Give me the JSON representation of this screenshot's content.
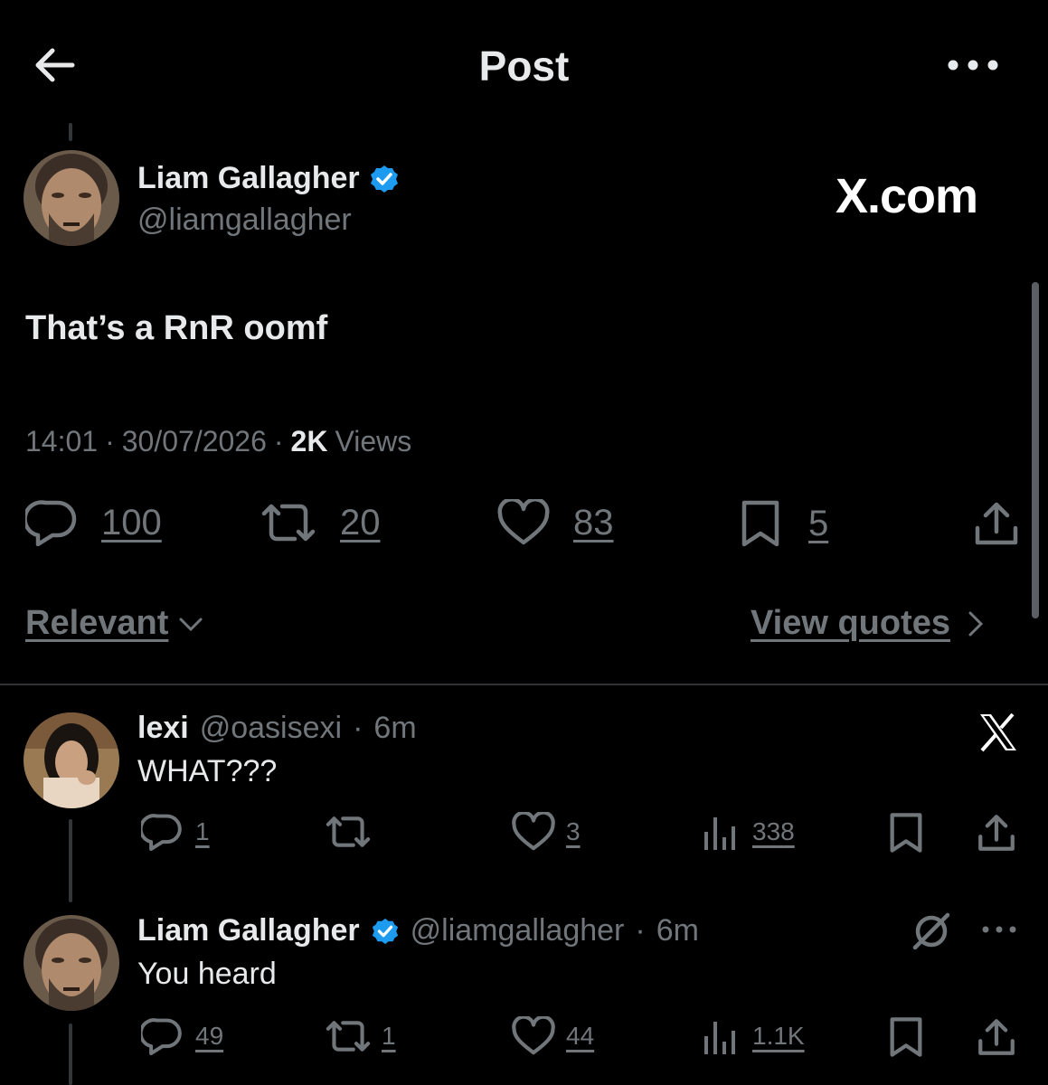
{
  "header": {
    "title": "Post"
  },
  "main_post": {
    "author_name": "Liam Gallagher",
    "author_handle": "@liamgallagher",
    "watermark": "X.com",
    "text": "That’s a RnR oomf",
    "time": "14:01",
    "date": "30/07/2026",
    "views_count": "2K",
    "views_label": "Views",
    "replies": "100",
    "reposts": "20",
    "likes": "83",
    "bookmarks": "5"
  },
  "sort": {
    "label": "Relevant",
    "view_quotes": "View quotes"
  },
  "replies": [
    {
      "name": "lexi",
      "handle": "@oasisexi",
      "time": "6m",
      "text": "WHAT???",
      "replies": "1",
      "reposts": "",
      "likes": "3",
      "views": "338"
    },
    {
      "name": "Liam Gallagher",
      "handle": "@liamgallagher",
      "time": "6m",
      "text": "You heard",
      "replies": "49",
      "reposts": "1",
      "likes": "44",
      "views": "1.1K"
    }
  ],
  "colors": {
    "background": "#000000",
    "text": "#e7e9ea",
    "muted": "#71767b",
    "verified": "#1d9bf0"
  }
}
